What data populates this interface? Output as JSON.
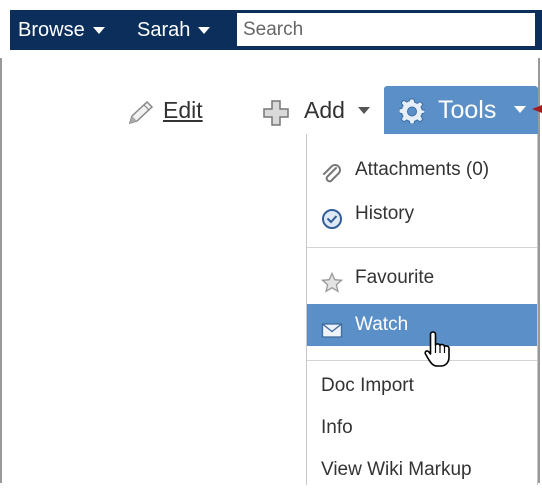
{
  "nav": {
    "browse_label": "Browse",
    "user_label": "Sarah",
    "search_placeholder": "Search"
  },
  "toolbar": {
    "edit_label": "Edit",
    "add_label": "Add",
    "tools_label": "Tools"
  },
  "menu": {
    "group1": [
      {
        "label": "Attachments (0)",
        "icon": "paperclip-icon"
      },
      {
        "label": "History",
        "icon": "clock-icon"
      }
    ],
    "group2": [
      {
        "label": "Favourite",
        "icon": "star-icon"
      },
      {
        "label": "Watch",
        "icon": "envelope-icon",
        "highlighted": true
      }
    ],
    "group3": [
      {
        "label": "Doc Import"
      },
      {
        "label": "Info"
      },
      {
        "label": "View Wiki Markup"
      }
    ]
  },
  "colors": {
    "nav_bg": "#0b2e5b",
    "accent": "#5b8fc7"
  }
}
